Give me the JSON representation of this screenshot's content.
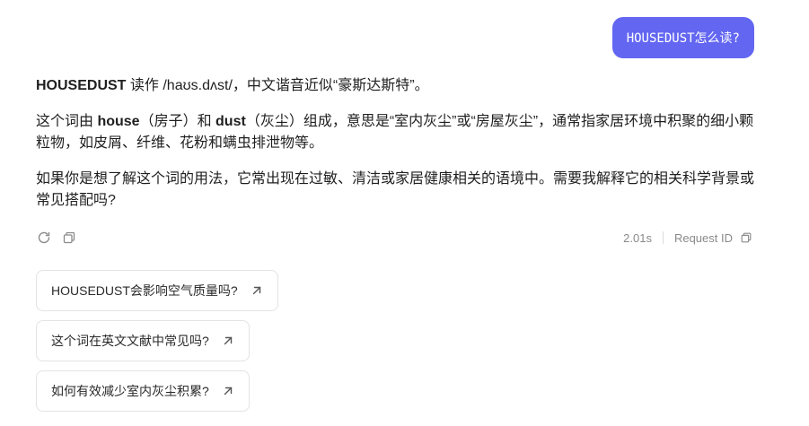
{
  "user_message": "HOUSEDUST怎么读?",
  "answer": {
    "p1": {
      "bold_word": "HOUSEDUST",
      "rest": " 读作 /haʊs.dʌst/，中文谐音近似“豪斯达斯特”。"
    },
    "p2": {
      "t1": "这个词由 ",
      "b1": "house",
      "t2": "（房子）和 ",
      "b2": "dust",
      "t3": "（灰尘）组成，意思是“室内灰尘”或“房屋灰尘”，通常指家居环境中积聚的细小颗粒物，如皮屑、纤维、花粉和螨虫排泄物等。"
    },
    "p3": "如果你是想了解这个词的用法，它常出现在过敏、清洁或家居健康相关的语境中。需要我解释它的相关科学背景或常见搭配吗?"
  },
  "actions": {
    "regenerate_icon": "refresh-icon",
    "copy_icon": "copy-icon",
    "duration": "2.01s",
    "request_id_label": "Request ID"
  },
  "suggestions": [
    "HOUSEDUST会影响空气质量吗?",
    "这个词在英文文献中常见吗?",
    "如何有效减少室内灰尘积累?"
  ],
  "colors": {
    "accent": "#6366f1",
    "muted": "#8a8a8a",
    "border": "#e3e3e3"
  }
}
